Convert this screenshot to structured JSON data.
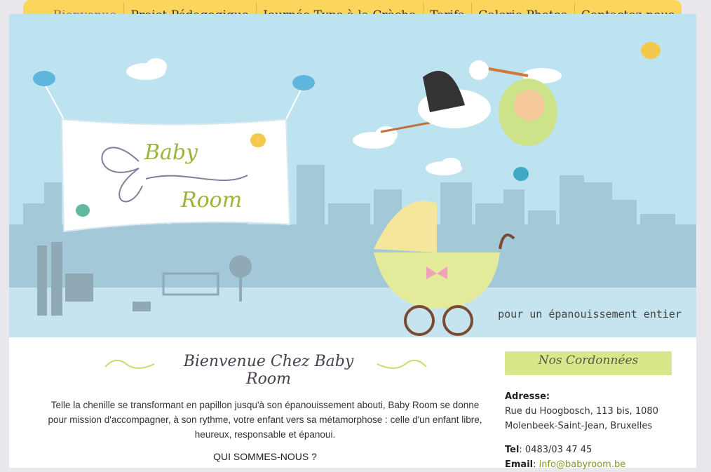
{
  "nav": {
    "items": [
      {
        "label": "Bienvenue",
        "active": true
      },
      {
        "label": "Projet Pédagogique"
      },
      {
        "label": "Journée Type à la Crèche"
      },
      {
        "label": "Tarifs"
      },
      {
        "label": "Galerie Photos"
      },
      {
        "label": "Contactez-nous"
      }
    ]
  },
  "hero": {
    "logo_line1": "Baby",
    "logo_line2": "Room",
    "tagline": "pour un épanouissement entier"
  },
  "main": {
    "welcome_title": "Bienvenue Chez Baby Room",
    "intro": "Telle la chenille se transformant en papillon jusqu'à son épanouissement abouti, Baby Room se donne pour mission d'accompagner, à son rythme, votre enfant vers sa métamorphose : celle d'un enfant libre, heureux, responsable et épanoui.",
    "section_heading": "QUI SOMMES-NOUS ?"
  },
  "sidebar": {
    "heading": "Nos Cordonnées",
    "address_label": "Adresse:",
    "address_line1": "Rue du Hoogbosch, 113 bis, 1080",
    "address_line2": "Molenbeek-Saint-Jean, Bruxelles",
    "tel_label": "Tel",
    "tel_value": ": 0483/03 47 45",
    "email_label": "Email",
    "email_sep": ": ",
    "email_value": "info@babyroom.be"
  },
  "colors": {
    "nav_bg": "#fcd55c",
    "sky": "#bde3f0",
    "city": "#9fc7d6",
    "logo_green": "#9ab53b",
    "accent_green": "#d6e88a"
  }
}
